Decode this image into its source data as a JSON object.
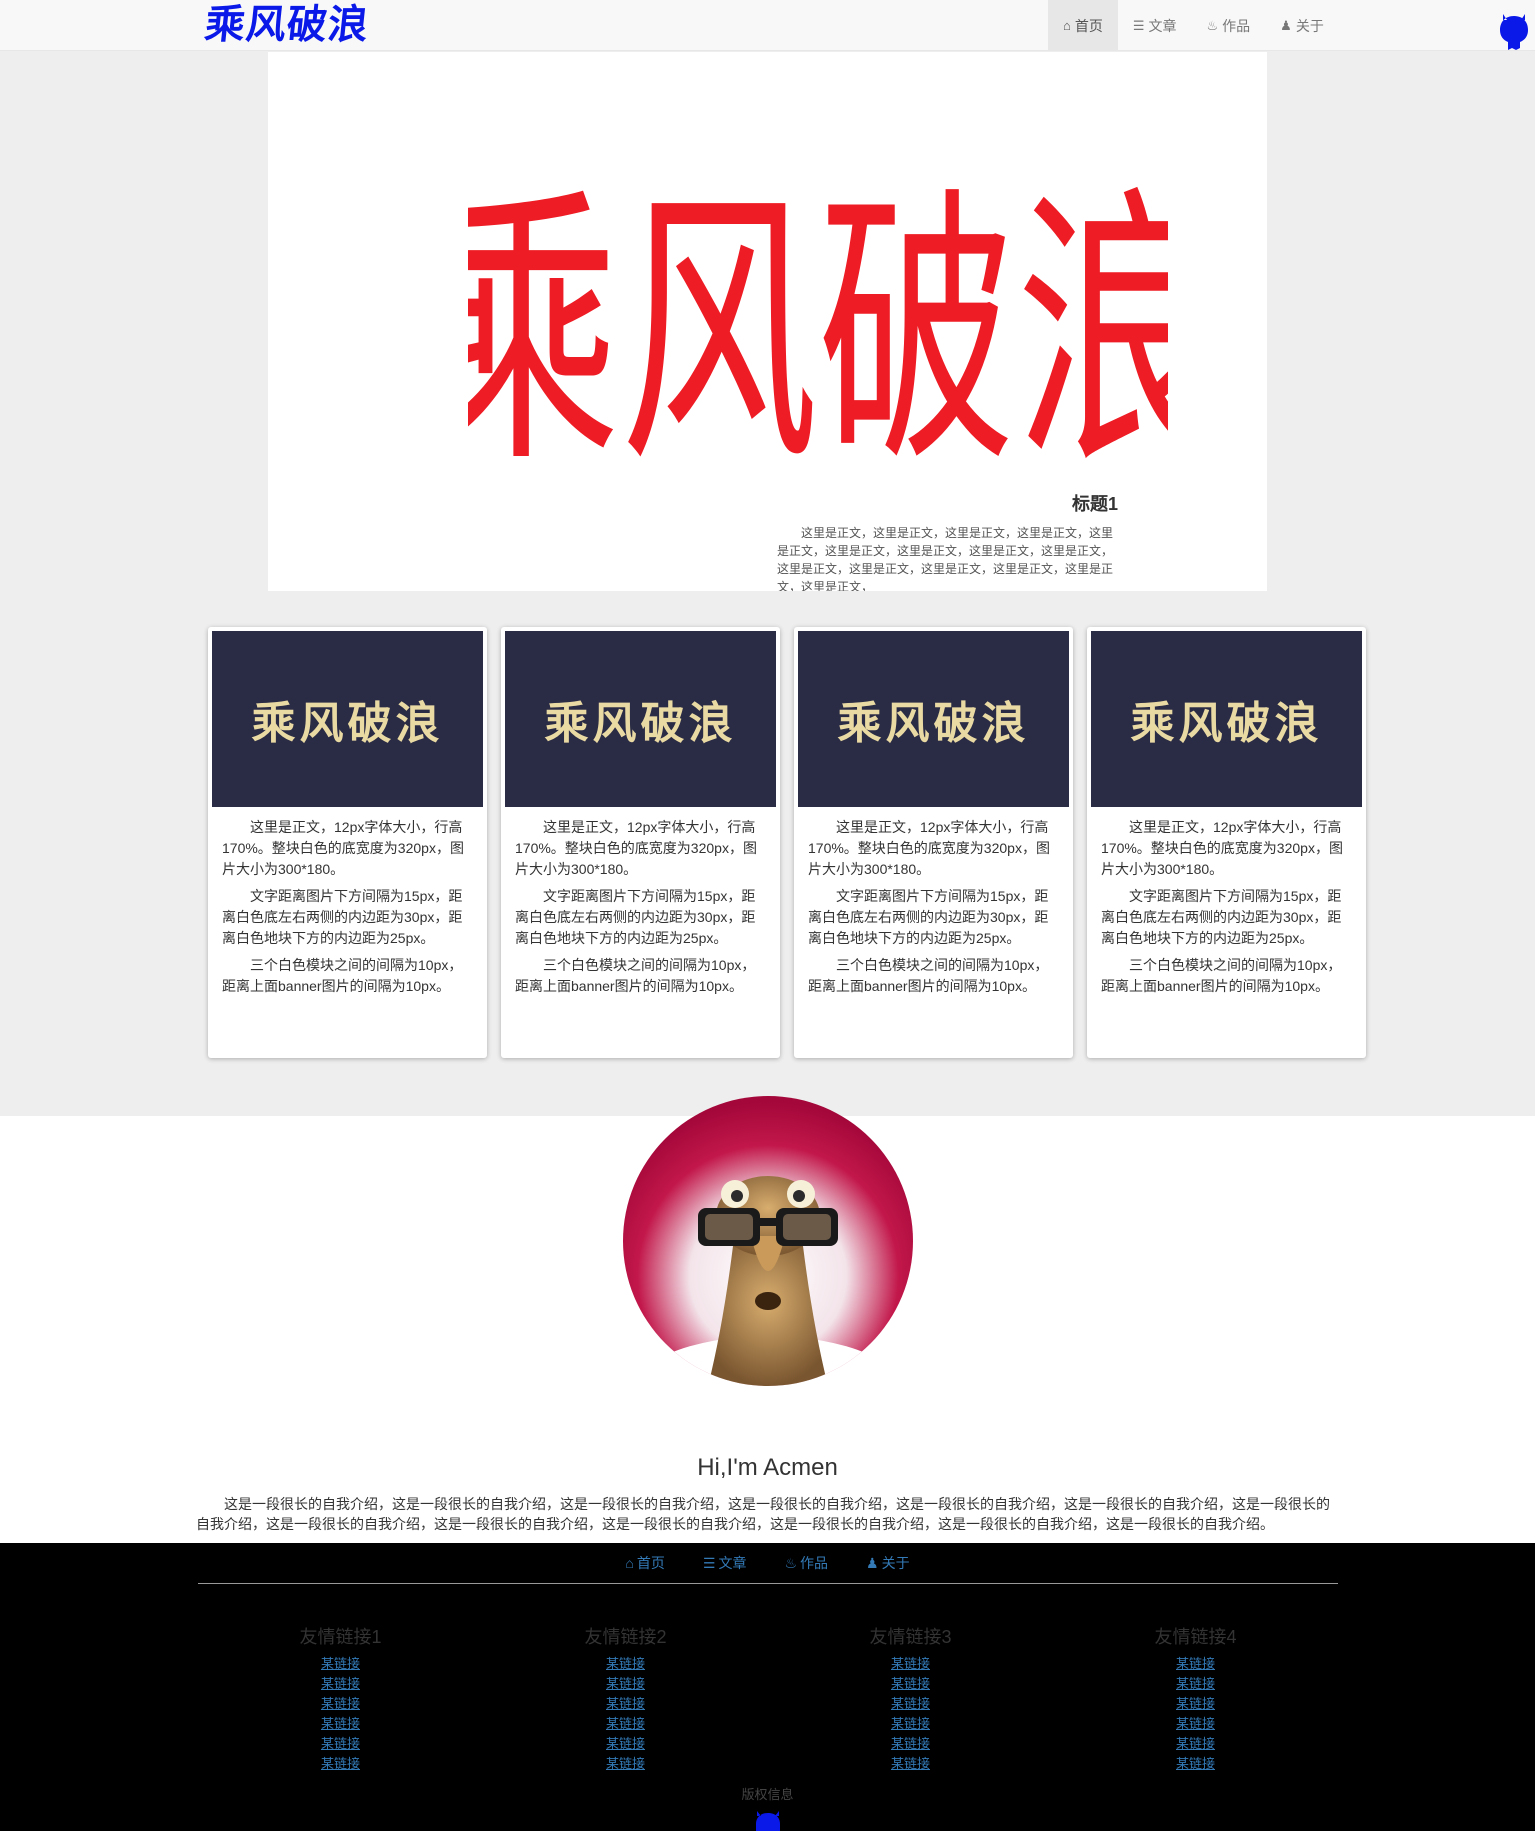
{
  "header": {
    "logo": "乘风破浪",
    "nav": [
      {
        "label": "首页",
        "icon": "home-icon",
        "active": true
      },
      {
        "label": "文章",
        "icon": "list-icon",
        "active": false
      },
      {
        "label": "作品",
        "icon": "fire-icon",
        "active": false
      },
      {
        "label": "关于",
        "icon": "user-icon",
        "active": false
      }
    ]
  },
  "banner": {
    "art_text": "乘风破浪",
    "title": "标题1",
    "text": "这里是正文，这里是正文，这里是正文，这里是正文，这里是正文，这里是正文，这里是正文，这里是正文，这里是正文，这里是正文，这里是正文，这里是正文，这里是正文，这里是正文，这里是正文，"
  },
  "cards": [
    {
      "image_text": "乘风破浪",
      "paragraphs": [
        "这里是正文，12px字体大小，行高170%。整块白色的底宽度为320px，图片大小为300*180。",
        "文字距离图片下方间隔为15px，距离白色底左右两侧的内边距为30px，距离白色地块下方的内边距为25px。",
        "三个白色模块之间的间隔为10px，距离上面banner图片的间隔为10px。"
      ]
    },
    {
      "image_text": "乘风破浪",
      "paragraphs": [
        "这里是正文，12px字体大小，行高170%。整块白色的底宽度为320px，图片大小为300*180。",
        "文字距离图片下方间隔为15px，距离白色底左右两侧的内边距为30px，距离白色地块下方的内边距为25px。",
        "三个白色模块之间的间隔为10px，距离上面banner图片的间隔为10px。"
      ]
    },
    {
      "image_text": "乘风破浪",
      "paragraphs": [
        "这里是正文，12px字体大小，行高170%。整块白色的底宽度为320px，图片大小为300*180。",
        "文字距离图片下方间隔为15px，距离白色底左右两侧的内边距为30px，距离白色地块下方的内边距为25px。",
        "三个白色模块之间的间隔为10px，距离上面banner图片的间隔为10px。"
      ]
    },
    {
      "image_text": "乘风破浪",
      "paragraphs": [
        "这里是正文，12px字体大小，行高170%。整块白色的底宽度为320px，图片大小为300*180。",
        "文字距离图片下方间隔为15px，距离白色底左右两侧的内边距为30px，距离白色地块下方的内边距为25px。",
        "三个白色模块之间的间隔为10px，距离上面banner图片的间隔为10px。"
      ]
    }
  ],
  "about": {
    "title": "Hi,I'm Acmen",
    "text": "这是一段很长的自我介绍，这是一段很长的自我介绍，这是一段很长的自我介绍，这是一段很长的自我介绍，这是一段很长的自我介绍，这是一段很长的自我介绍，这是一段很长的自我介绍，这是一段很长的自我介绍，这是一段很长的自我介绍，这是一段很长的自我介绍，这是一段很长的自我介绍，这是一段很长的自我介绍，这是一段很长的自我介绍。"
  },
  "footer": {
    "nav": [
      {
        "label": "首页",
        "icon": "home-icon"
      },
      {
        "label": "文章",
        "icon": "list-icon"
      },
      {
        "label": "作品",
        "icon": "fire-icon"
      },
      {
        "label": "关于",
        "icon": "user-icon"
      }
    ],
    "columns": [
      {
        "title": "友情链接1",
        "links": [
          "某链接",
          "某链接",
          "某链接",
          "某链接",
          "某链接",
          "某链接"
        ]
      },
      {
        "title": "友情链接2",
        "links": [
          "某链接",
          "某链接",
          "某链接",
          "某链接",
          "某链接",
          "某链接"
        ]
      },
      {
        "title": "友情链接3",
        "links": [
          "某链接",
          "某链接",
          "某链接",
          "某链接",
          "某链接",
          "某链接"
        ]
      },
      {
        "title": "友情链接4",
        "links": [
          "某链接",
          "某链接",
          "某链接",
          "某链接",
          "某链接",
          "某链接"
        ]
      }
    ],
    "copyright": "版权信息"
  },
  "colors": {
    "logo": "#0a19e8",
    "banner_art": "#ee1c24",
    "card_image_bg": "#2a2b45",
    "card_image_text": "#e9d9a3",
    "link": "#337ab7",
    "footer_bg": "#000000"
  }
}
